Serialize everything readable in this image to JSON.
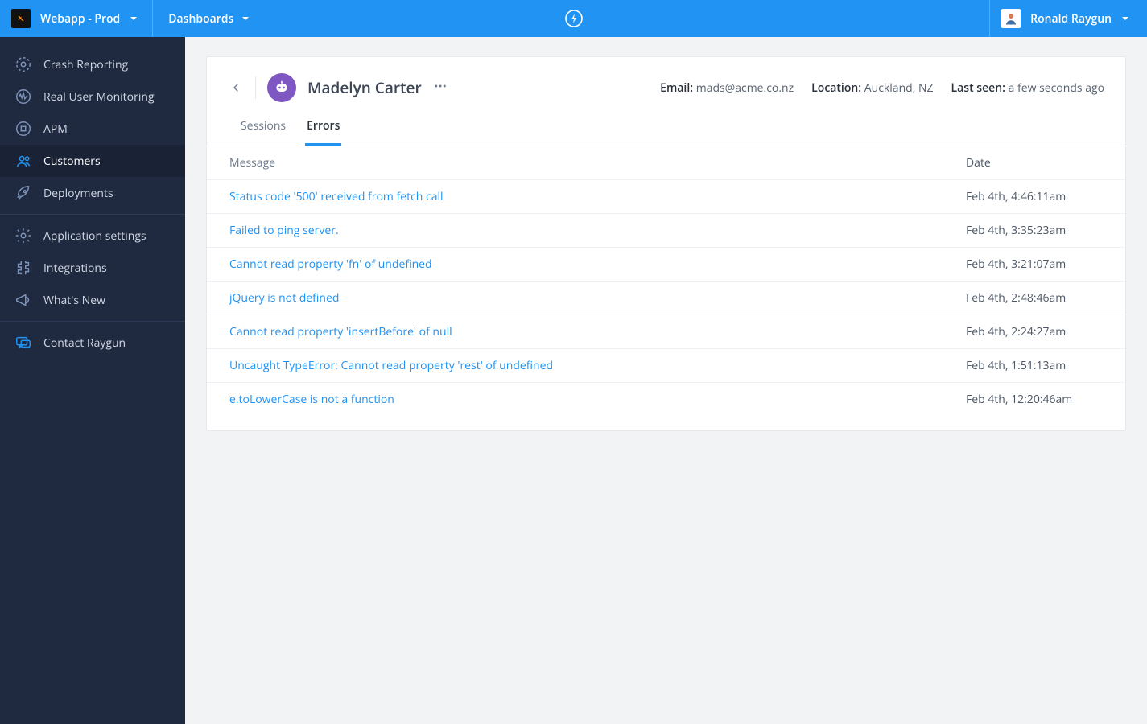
{
  "topbar": {
    "app_name": "Webapp - Prod",
    "nav_dashboards": "Dashboards",
    "user_name": "Ronald Raygun"
  },
  "sidebar": {
    "groups": [
      {
        "items": [
          {
            "id": "crash-reporting",
            "label": "Crash Reporting"
          },
          {
            "id": "rum",
            "label": "Real User Monitoring"
          },
          {
            "id": "apm",
            "label": "APM"
          },
          {
            "id": "customers",
            "label": "Customers",
            "active": true
          },
          {
            "id": "deployments",
            "label": "Deployments"
          }
        ]
      },
      {
        "items": [
          {
            "id": "app-settings",
            "label": "Application settings"
          },
          {
            "id": "integrations",
            "label": "Integrations"
          },
          {
            "id": "whats-new",
            "label": "What's New"
          }
        ]
      },
      {
        "items": [
          {
            "id": "contact",
            "label": "Contact Raygun"
          }
        ]
      }
    ]
  },
  "customer": {
    "name": "Madelyn Carter",
    "meta": {
      "email_label": "Email:",
      "email_value": "mads@acme.co.nz",
      "location_label": "Location:",
      "location_value": "Auckland, NZ",
      "lastseen_label": "Last seen:",
      "lastseen_value": "a few seconds ago"
    },
    "tabs": [
      {
        "id": "sessions",
        "label": "Sessions",
        "active": false
      },
      {
        "id": "errors",
        "label": "Errors",
        "active": true
      }
    ]
  },
  "table": {
    "headers": {
      "message": "Message",
      "date": "Date"
    },
    "rows": [
      {
        "message": "Status code '500' received from fetch call",
        "date": "Feb 4th, 4:46:11am"
      },
      {
        "message": "Failed to ping server.",
        "date": "Feb 4th, 3:35:23am"
      },
      {
        "message": "Cannot read property 'fn' of undefined",
        "date": "Feb 4th, 3:21:07am"
      },
      {
        "message": "jQuery is not defined",
        "date": "Feb 4th, 2:48:46am"
      },
      {
        "message": "Cannot read property 'insertBefore' of null",
        "date": "Feb 4th, 2:24:27am"
      },
      {
        "message": "Uncaught TypeError: Cannot read property 'rest' of undefined",
        "date": "Feb 4th, 1:51:13am"
      },
      {
        "message": "e.toLowerCase is not a function",
        "date": "Feb 4th, 12:20:46am"
      }
    ]
  }
}
